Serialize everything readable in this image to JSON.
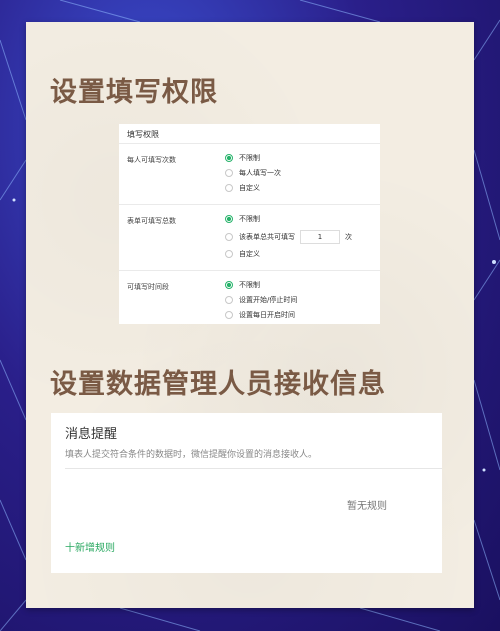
{
  "section1": {
    "heading": "设置填写权限",
    "card_title": "填写权限",
    "groups": [
      {
        "label": "每人可填写次数",
        "options": [
          "不限制",
          "每人填写一次",
          "自定义"
        ],
        "selected": 0
      },
      {
        "label": "表单可填写总数",
        "options": [
          "不限制",
          "该表单总共可填写",
          "自定义"
        ],
        "selected": 0,
        "count_value": "1",
        "count_unit": "次"
      },
      {
        "label": "可填写时间段",
        "options": [
          "不限制",
          "设置开始/停止时间",
          "设置每日开启时间"
        ],
        "selected": 0
      }
    ]
  },
  "section2": {
    "heading": "设置数据管理人员接收信息",
    "card_title": "消息提醒",
    "description": "填表人提交符合条件的数据时，微信提醒你设置的消息接收人。",
    "empty_text": "暂无规则",
    "add_rule_label": "十新增规则"
  },
  "colors": {
    "accent_green": "#27b36b",
    "heading_brown": "#7a5a45",
    "background_purple": "#2a1f8a"
  }
}
